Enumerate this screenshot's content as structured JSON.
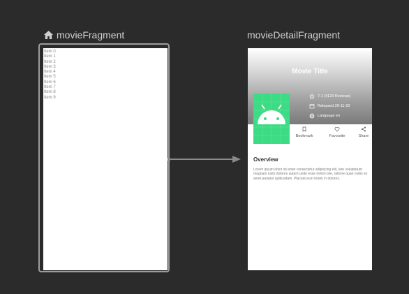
{
  "start_destination": {
    "label": "movieFragment",
    "icon": "home-icon",
    "items": [
      "Item 0",
      "Item 1",
      "Item 2",
      "Item 3",
      "Item 4",
      "Item 5",
      "Item 6",
      "Item 7",
      "Item 8",
      "Item 9"
    ]
  },
  "detail_destination": {
    "label": "movieDetailFragment",
    "title": "Movie Title",
    "rating": "7.1 (4123 Reviews)",
    "released": "Released 20-11-20",
    "language": "Language en",
    "actions": {
      "bookmark": "Bookmark",
      "favourite": "Favourite",
      "share": "Share"
    },
    "overview_heading": "Overview",
    "overview_text": "Lorem ipsum dolor sit amet consectetur adipiscing elit, lare voluptatum magnam iusto dolores autem unde esse minim iste, ratione quae nobis ex amet pariatur quibusdam. Placeat eum totam in dolores."
  },
  "colors": {
    "canvas": "#2b2b2c",
    "label": "#d0d0d0",
    "frame": "#9d9d9d",
    "poster": "#3ddc84"
  }
}
